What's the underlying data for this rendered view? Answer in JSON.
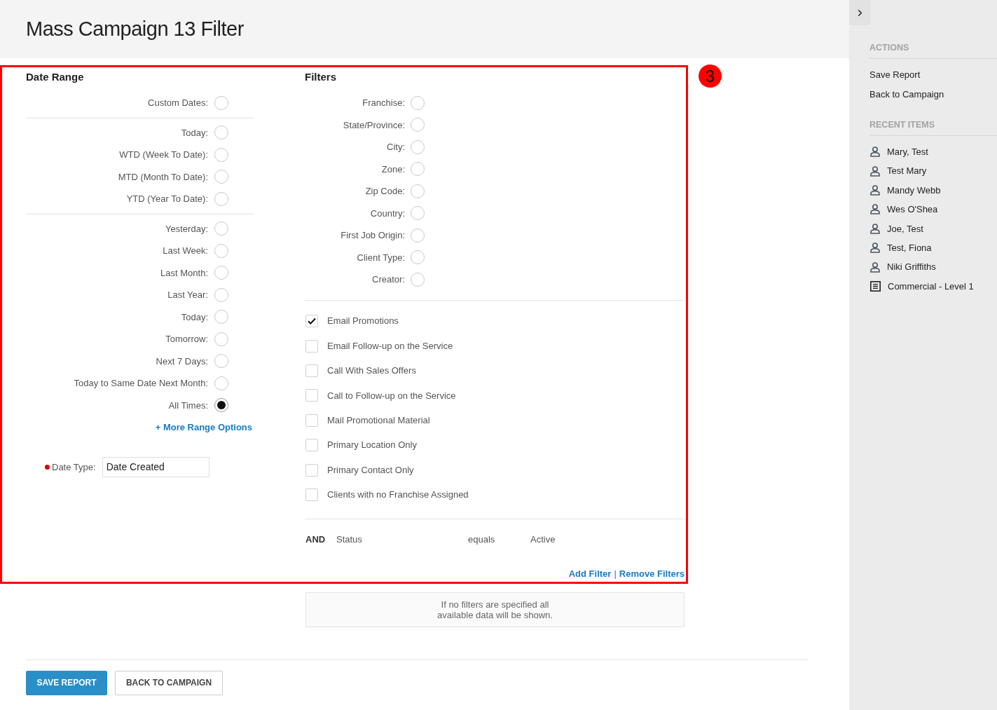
{
  "header": {
    "title": "Mass Campaign 13 Filter"
  },
  "annotation": {
    "label": "3"
  },
  "date_range": {
    "heading": "Date Range",
    "groups": [
      {
        "options": [
          {
            "label": "Custom Dates:",
            "selected": false
          }
        ]
      },
      {
        "options": [
          {
            "label": "Today:",
            "selected": false
          },
          {
            "label": "WTD (Week To Date):",
            "selected": false
          },
          {
            "label": "MTD (Month To Date):",
            "selected": false
          },
          {
            "label": "YTD (Year To Date):",
            "selected": false
          }
        ]
      },
      {
        "options": [
          {
            "label": "Yesterday:",
            "selected": false
          },
          {
            "label": "Last Week:",
            "selected": false
          },
          {
            "label": "Last Month:",
            "selected": false
          },
          {
            "label": "Last Year:",
            "selected": false
          },
          {
            "label": "Today:",
            "selected": false
          },
          {
            "label": "Tomorrow:",
            "selected": false
          },
          {
            "label": "Next 7 Days:",
            "selected": false
          },
          {
            "label": "Today to Same Date Next Month:",
            "selected": false
          },
          {
            "label": "All Times:",
            "selected": true
          }
        ]
      }
    ],
    "more_link": "+ More Range Options",
    "date_type": {
      "label": "Date Type:",
      "required": true,
      "value": "Date Created"
    }
  },
  "filters": {
    "heading": "Filters",
    "fields": [
      {
        "label": "Franchise:",
        "checked": false
      },
      {
        "label": "State/Province:",
        "checked": false
      },
      {
        "label": "City:",
        "checked": false
      },
      {
        "label": "Zone:",
        "checked": false
      },
      {
        "label": "Zip Code:",
        "checked": false
      },
      {
        "label": "Country:",
        "checked": false
      },
      {
        "label": "First Job Origin:",
        "checked": false
      },
      {
        "label": "Client Type:",
        "checked": false
      },
      {
        "label": "Creator:",
        "checked": false
      }
    ],
    "options": [
      {
        "label": "Email Promotions",
        "checked": true
      },
      {
        "label": "Email Follow-up on the Service",
        "checked": false
      },
      {
        "label": "Call With Sales Offers",
        "checked": false
      },
      {
        "label": "Call to Follow-up on the Service",
        "checked": false
      },
      {
        "label": "Mail Promotional Material",
        "checked": false
      },
      {
        "label": "Primary Location Only",
        "checked": false
      },
      {
        "label": "Primary Contact Only",
        "checked": false
      },
      {
        "label": "Clients with no Franchise Assigned",
        "checked": false
      }
    ],
    "condition": {
      "conjunction": "AND",
      "field": "Status",
      "operator": "equals",
      "value": "Active"
    },
    "links": [
      "Add Filter",
      "Remove Filters"
    ],
    "link_separator": "|"
  },
  "note": {
    "lines": [
      "If no filters are specified all",
      "available data will be shown."
    ]
  },
  "buttons": [
    {
      "label": "SAVE REPORT",
      "kind": "primary"
    },
    {
      "label": "BACK TO CAMPAIGN",
      "kind": "secondary"
    }
  ],
  "sidebar": {
    "actions": {
      "heading": "ACTIONS",
      "items": [
        "Save Report",
        "Back to Campaign"
      ]
    },
    "recent": {
      "heading": "RECENT ITEMS",
      "items": [
        {
          "label": "Mary, Test",
          "kind": "person"
        },
        {
          "label": "Test Mary",
          "kind": "person"
        },
        {
          "label": "Mandy Webb",
          "kind": "person"
        },
        {
          "label": "Wes O'Shea",
          "kind": "person"
        },
        {
          "label": "Joe, Test",
          "kind": "person"
        },
        {
          "label": "Test, Fiona",
          "kind": "person"
        },
        {
          "label": "Niki Griffiths",
          "kind": "person"
        },
        {
          "label": "Commercial - Level 1",
          "kind": "document"
        }
      ]
    }
  }
}
